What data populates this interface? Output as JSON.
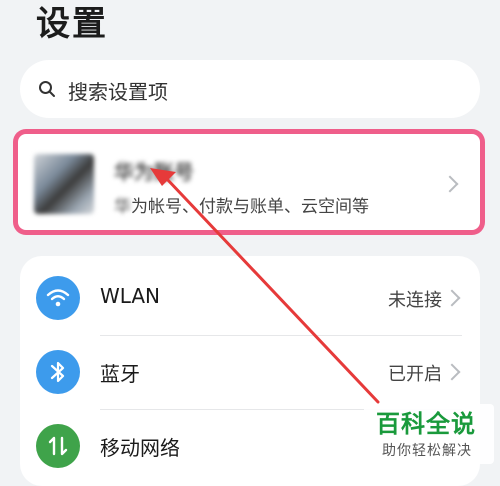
{
  "page": {
    "title": "设置"
  },
  "search": {
    "placeholder": "搜索设置项"
  },
  "account": {
    "name": "华为账号",
    "subtitle_blurred": "华",
    "subtitle": "为帐号、付款与账单、云空间等"
  },
  "settings": [
    {
      "label": "WLAN",
      "value": "未连接",
      "icon": "wifi-icon",
      "color": "#3d9bec"
    },
    {
      "label": "蓝牙",
      "value": "已开启",
      "icon": "bluetooth-icon",
      "color": "#3d9bec"
    },
    {
      "label": "移动网络",
      "value": "",
      "icon": "mobile-network-icon",
      "color": "#3fa34a"
    }
  ],
  "annotation": {
    "highlight_color": "#ef5e8a",
    "arrow_color": "#e63a3a"
  },
  "watermark": {
    "title": "百科全说",
    "subtitle": "助你轻松解决"
  }
}
